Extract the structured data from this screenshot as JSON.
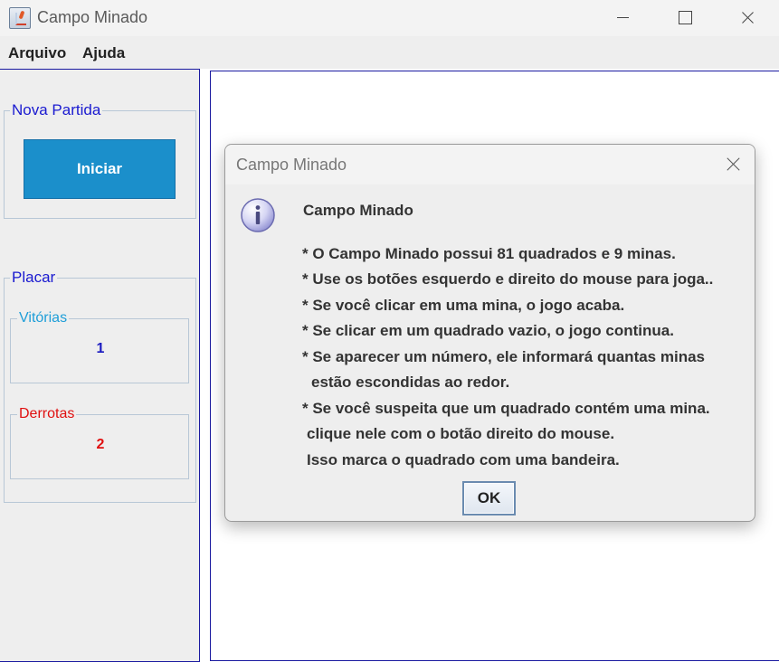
{
  "window": {
    "title": "Campo Minado",
    "icon": "java-cup-icon"
  },
  "menu": {
    "items": [
      "Arquivo",
      "Ajuda"
    ]
  },
  "sidebar": {
    "nova_partida": {
      "legend": "Nova Partida",
      "button_label": "Iniciar"
    },
    "placar": {
      "legend": "Placar",
      "vitorias": {
        "label": "Vitórias",
        "value": "1"
      },
      "derrotas": {
        "label": "Derrotas",
        "value": "2"
      }
    }
  },
  "dialog": {
    "title": "Campo Minado",
    "icon": "info-icon",
    "heading": "Campo Minado",
    "lines": [
      "* O Campo Minado possui 81 quadrados e 9 minas.",
      "* Use os botões esquerdo e direito do mouse para joga..",
      "* Se você clicar em uma mina, o jogo acaba.",
      "* Se clicar em um quadrado vazio, o jogo continua.",
      "* Se aparecer um número, ele informará quantas minas",
      "estão escondidas ao redor.",
      "* Se você suspeita que um quadrado contém uma mina.",
      "clique nele com o botão direito do mouse.",
      "Isso marca o quadrado com uma bandeira."
    ],
    "ok_label": "OK"
  },
  "colors": {
    "accent_button": "#1b8fcb",
    "legend_blue": "#1a1ad0",
    "vitorias_label": "#1e9ed8",
    "derrotas": "#e01010",
    "border_blue": "#1a1aa0"
  }
}
